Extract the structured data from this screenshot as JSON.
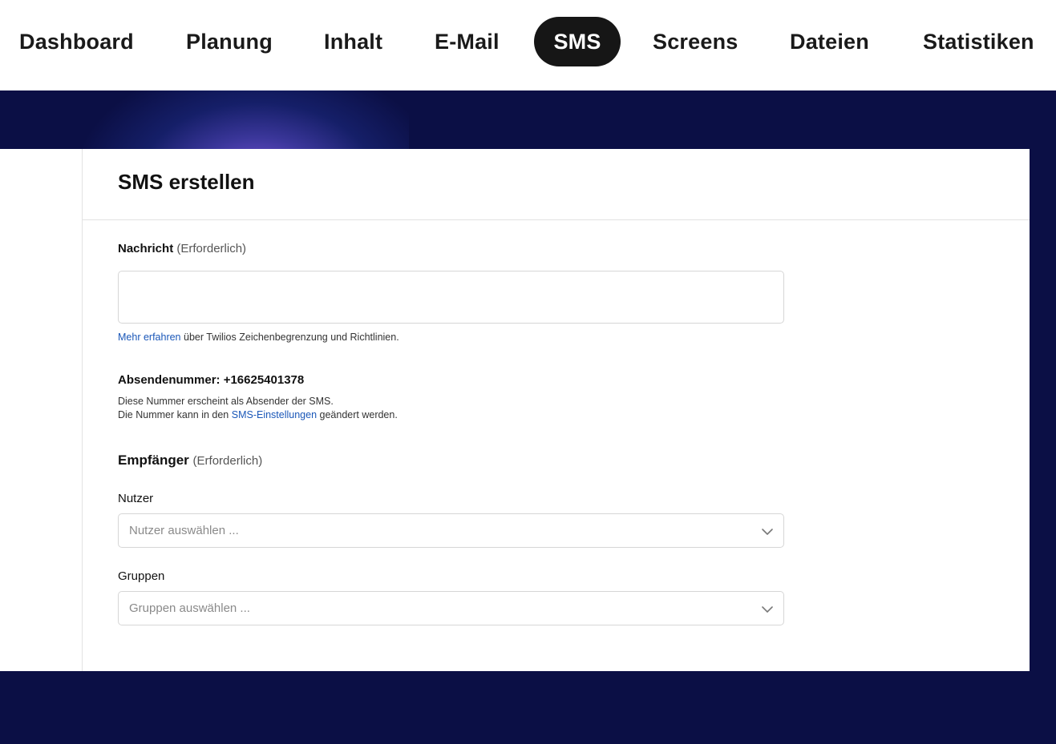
{
  "nav": {
    "items": [
      {
        "label": "Dashboard",
        "active": false
      },
      {
        "label": "Planung",
        "active": false
      },
      {
        "label": "Inhalt",
        "active": false
      },
      {
        "label": "E-Mail",
        "active": false
      },
      {
        "label": "SMS",
        "active": true
      },
      {
        "label": "Screens",
        "active": false
      },
      {
        "label": "Dateien",
        "active": false
      },
      {
        "label": "Statistiken",
        "active": false
      }
    ]
  },
  "colors": {
    "background": "#0b0f45",
    "active_nav_bg": "#161616",
    "link": "#1a57b8"
  },
  "form": {
    "title": "SMS erstellen",
    "message": {
      "label": "Nachricht",
      "required_hint": "(Erforderlich)",
      "value": "",
      "help_link": "Mehr erfahren",
      "help_text": " über Twilios Zeichenbegrenzung und Richtlinien."
    },
    "sender": {
      "label": "Absendenummer: +16625401378",
      "desc_line1": "Diese Nummer erscheint als Absender der SMS.",
      "desc_line2_prefix": "Die Nummer kann in den ",
      "desc_line2_link": "SMS-Einstellungen",
      "desc_line2_suffix": " geändert werden."
    },
    "recipients": {
      "label": "Empfänger",
      "required_hint": "(Erforderlich)",
      "users": {
        "label": "Nutzer",
        "placeholder": "Nutzer auswählen ...",
        "icon": "chevron-down-icon"
      },
      "groups": {
        "label": "Gruppen",
        "placeholder": "Gruppen auswählen ...",
        "icon": "chevron-down-icon"
      }
    }
  }
}
